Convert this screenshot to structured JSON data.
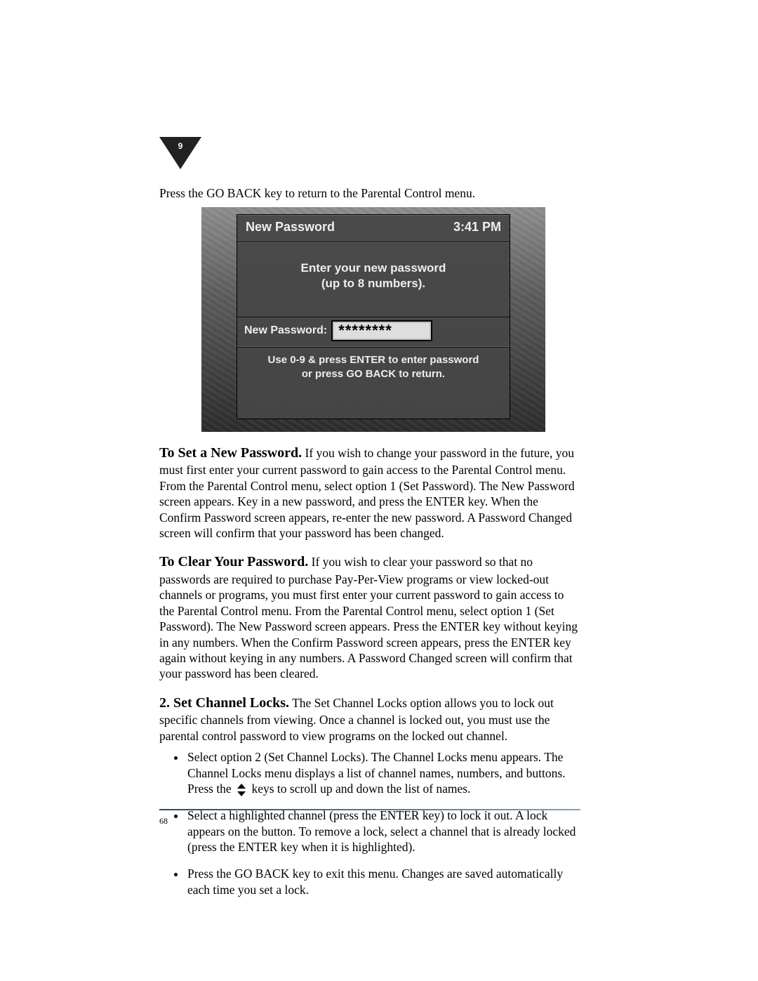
{
  "tab": {
    "number": "9"
  },
  "lead": "Press the GO BACK key to return to the Parental Control menu.",
  "screenshot": {
    "title": "New Password",
    "time": "3:41 PM",
    "instruction_line1": "Enter your new password",
    "instruction_line2": "(up to 8 numbers).",
    "field_label": "New Password:",
    "field_value": "********",
    "hint_line1": "Use 0-9 & press ENTER to enter password",
    "hint_line2": "or press GO BACK to return."
  },
  "sections": {
    "set_password": {
      "heading": "To Set a New Password.",
      "body": "If you wish to change your password in the future, you must first enter your current password to gain access to the Parental Control menu. From the Parental Control menu, select option 1 (Set Password). The New Password screen appears. Key in a new password, and press the ENTER key. When the Confirm Password screen appears, re-enter the new password. A Password Changed screen will confirm that your password has been changed."
    },
    "clear_password": {
      "heading": "To Clear Your Password.",
      "body": "If you wish to clear your password so that no passwords are required to purchase Pay-Per-View programs or view locked-out channels or programs, you must first enter your current password to gain access to the Parental Control menu. From the Parental Control menu, select option 1 (Set Password). The New Password screen appears. Press the ENTER key without keying in any numbers. When the Confirm Password screen appears, press the ENTER key again without keying in any numbers. A Password Changed screen will confirm that your password has been cleared."
    },
    "channel_locks": {
      "heading": "2. Set Channel Locks.",
      "body": "The Set Channel Locks option allows you to lock out specific channels from viewing. Once a channel is locked out, you must use the parental control password to view programs on the locked out channel.",
      "bullets": {
        "b1_before": "Select option 2 (Set Channel Locks). The Channel Locks menu appears. The Channel Locks menu displays a list of channel names, numbers, and buttons. Press the ",
        "b1_after": " keys to scroll up and down the list of names.",
        "b2": "Select a highlighted channel (press the ENTER key) to lock it out. A lock appears on the button. To remove a lock, select a channel that is already locked (press the ENTER key when it is highlighted).",
        "b3": "Press the GO BACK key to exit this menu. Changes are saved automatically each time you set a lock."
      }
    }
  },
  "page_number": "68"
}
